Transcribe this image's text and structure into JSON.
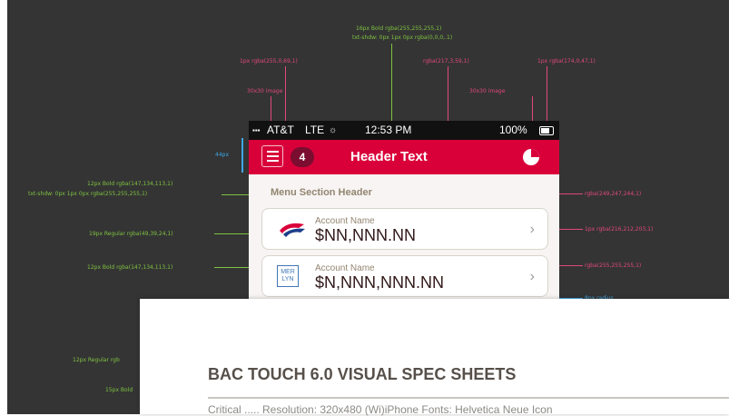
{
  "annotations": {
    "header_text_spec": "16px Bold rgba(255,255,255,1)",
    "header_text_shadow": "txt-shdw: 0px 1px 0px rgba(0,0,0,.1)",
    "border_spec": "1px rgba(255,0,69,1)",
    "image_spec_left": "30x30 image",
    "header_bg_spec": "rgba(217,3,59,1)",
    "image_spec_right": "30x30 image",
    "border_spec_right": "1px rgba(174,0,47,1)",
    "height_spec": "44px",
    "width_spec": "14",
    "spacing_spec": "0px",
    "section_header_spec": "12px Bold rgba(147,134,113,1)",
    "section_header_shadow": "txt-shdw: 0px 1px 0px rgba(255,255,255,1)",
    "section_bg_spec": "rgba(249,247,244,1)",
    "value_spec": "19px Regular rgba(49,39,24,1)",
    "card_border_spec": "1px rgba(216,212,203,1)",
    "label_spec": "12px Bold rgba(147,134,113,1)",
    "card_bg_spec": "rgba(255,255,255,1)",
    "radius_spec": "8px radius",
    "regular_spec_cut": "12px Regular rgb",
    "bold_spec_cut": "15px Bold"
  },
  "phone": {
    "status": {
      "carrier": "AT&T",
      "network": "LTE",
      "time": "12:53 PM",
      "battery": "100%"
    },
    "header": {
      "badge_count": "4",
      "title": "Header Text"
    },
    "section_header": "Menu Section Header",
    "accounts": [
      {
        "label": "Account Name",
        "value": "$NN,NNN.NN"
      },
      {
        "label": "Account Name",
        "value": "$N,NNN,NNN.NN"
      }
    ],
    "card_logo_text": "MER LYN"
  },
  "document": {
    "title": "BAC TOUCH 6.0 VISUAL SPEC SHEETS",
    "subtitle": "Critical ..... Resolution: 320x480 (Wi)iPhone Fonts: Helvetica Neue Icon"
  },
  "colors": {
    "canvas_bg": "#343434",
    "header_bg": "#d9003a",
    "badge_bg": "#7a0d30",
    "annotation_green": "#7ec241",
    "annotation_pink": "#e0487c",
    "annotation_blue": "#3ea8e6"
  }
}
